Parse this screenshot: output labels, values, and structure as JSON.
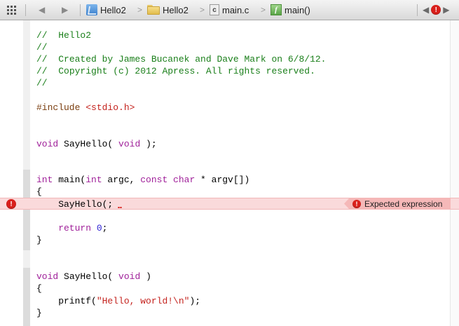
{
  "jumpbar": {
    "icons": {
      "related": "grid-icon",
      "back": "triangle-left",
      "forward": "triangle-right",
      "project": "xcode-project-icon",
      "folder": "folder-icon",
      "file": "c-file-icon",
      "function": "function-icon",
      "error": "error-icon"
    },
    "crumbs": {
      "project": "Hello2",
      "group": "Hello2",
      "file": "main.c",
      "file_icon_letter": "c",
      "function": "main()",
      "function_icon_letter": "f"
    },
    "chevron": ">",
    "back_glyph": "◀",
    "forward_glyph": "▶",
    "error_glyph": "!"
  },
  "editor": {
    "lines": {
      "l1a": "//",
      "l1b": "Hello2",
      "l2": "//",
      "l3a": "//",
      "l3b": "Created by James Bucanek and Dave Mark on 6/8/12.",
      "l4a": "//",
      "l4b": "Copyright (c) 2012 Apress. All rights reserved.",
      "l5": "//",
      "l6a": "#include ",
      "l6b": "<stdio.h>",
      "l7a": "void",
      "l7b": " SayHello( ",
      "l7c": "void",
      "l7d": " );",
      "l8a": "int",
      "l8b": " main(",
      "l8c": "int",
      "l8d": " argc, ",
      "l8e": "const char",
      "l8f": " * argv[])",
      "l9": "{",
      "l10": "    SayHello(;",
      "l11a": "    return ",
      "l11b": "0",
      "l11c": ";",
      "l12": "}",
      "l13a": "void",
      "l13b": " SayHello( ",
      "l13c": "void",
      "l13d": " )",
      "l14": "{",
      "l15a": "    printf(",
      "l15b": "\"Hello, world!\\n\"",
      "l15c": ");",
      "l16": "}"
    },
    "error": {
      "message": "Expected expression",
      "glyph": "!"
    }
  },
  "colors": {
    "comment": "#1a7f1a",
    "keyword": "#a0219a",
    "preprocessor": "#7a3e0f",
    "string": "#c4221d",
    "number": "#2a1fd3",
    "error": "#d9201c",
    "error_line_bg": "#fadadb"
  }
}
